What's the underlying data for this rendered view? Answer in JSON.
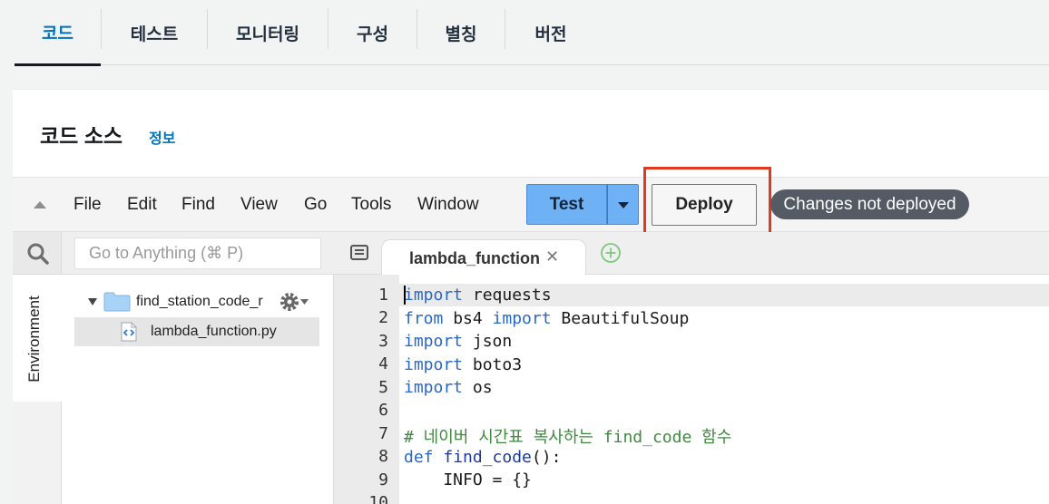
{
  "tabs": [
    {
      "label": "코드",
      "active": true
    },
    {
      "label": "테스트",
      "active": false
    },
    {
      "label": "모니터링",
      "active": false
    },
    {
      "label": "구성",
      "active": false
    },
    {
      "label": "별칭",
      "active": false
    },
    {
      "label": "버전",
      "active": false
    }
  ],
  "section": {
    "title": "코드 소스",
    "info_link": "정보"
  },
  "menu": [
    "File",
    "Edit",
    "Find",
    "View",
    "Go",
    "Tools",
    "Window"
  ],
  "toolbar": {
    "test_label": "Test",
    "deploy_label": "Deploy",
    "status": "Changes not deployed"
  },
  "sidebar": {
    "environment_label": "Environment",
    "search_placeholder": "Go to Anything (⌘ P)",
    "tree": {
      "folder": "find_station_code_r",
      "file": "lambda_function.py"
    }
  },
  "editor": {
    "tab_label": "lambda_function",
    "line_numbers": [
      "1",
      "2",
      "3",
      "4",
      "5",
      "6",
      "7",
      "8",
      "9",
      "10"
    ],
    "lines": [
      [
        {
          "t": "import",
          "k": "kw"
        },
        {
          "t": " requests",
          "k": ""
        }
      ],
      [
        {
          "t": "from",
          "k": "kw"
        },
        {
          "t": " bs4 ",
          "k": ""
        },
        {
          "t": "import",
          "k": "kw"
        },
        {
          "t": " BeautifulSoup",
          "k": ""
        }
      ],
      [
        {
          "t": "import",
          "k": "kw"
        },
        {
          "t": " json",
          "k": ""
        }
      ],
      [
        {
          "t": "import",
          "k": "kw"
        },
        {
          "t": " boto3",
          "k": ""
        }
      ],
      [
        {
          "t": "import",
          "k": "kw"
        },
        {
          "t": " os",
          "k": ""
        }
      ],
      [],
      [
        {
          "t": "# 네이버 시간표 복사하는 find_code 함수",
          "k": "cm"
        }
      ],
      [
        {
          "t": "def",
          "k": "kw"
        },
        {
          "t": " ",
          "k": ""
        },
        {
          "t": "find_code",
          "k": "fn"
        },
        {
          "t": "():",
          "k": ""
        }
      ],
      [
        {
          "t": "    INFO = {}",
          "k": ""
        }
      ],
      []
    ]
  },
  "colors": {
    "accent": "#0073bb",
    "test_button": "#6fb1f5",
    "highlight_box": "#e03a1e",
    "status_pill": "#545b64"
  }
}
